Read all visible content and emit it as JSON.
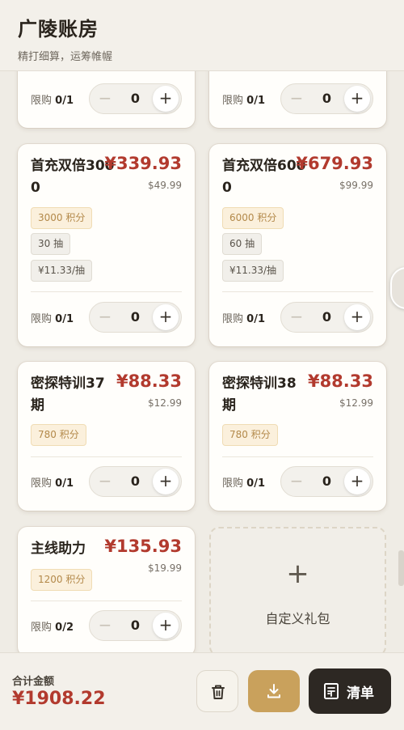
{
  "header": {
    "title": "广陵账房",
    "subtitle": "精打细算，运筹帷幄"
  },
  "top_partial": [
    {
      "limit_label": "限购",
      "limit": "0/1",
      "qty": "0",
      "minus": "−",
      "plus": "+"
    },
    {
      "limit_label": "限购",
      "limit": "0/1",
      "qty": "0",
      "minus": "−",
      "plus": "+"
    }
  ],
  "cards": [
    {
      "name": "首充双倍3000",
      "price": "¥339.93",
      "usd": "$49.99",
      "points_tag": "3000 积分",
      "tags": [
        "30 抽",
        "¥11.33/抽"
      ],
      "limit_label": "限购",
      "limit": "0/1",
      "qty": "0",
      "minus": "−",
      "plus": "+"
    },
    {
      "name": "首充双倍6000",
      "price": "¥679.93",
      "usd": "$99.99",
      "points_tag": "6000 积分",
      "tags": [
        "60 抽",
        "¥11.33/抽"
      ],
      "limit_label": "限购",
      "limit": "0/1",
      "qty": "0",
      "minus": "−",
      "plus": "+"
    },
    {
      "name": "密探特训37期",
      "price": "¥88.33",
      "usd": "$12.99",
      "points_tag": "780 积分",
      "limit_label": "限购",
      "limit": "0/1",
      "qty": "0",
      "minus": "−",
      "plus": "+"
    },
    {
      "name": "密探特训38期",
      "price": "¥88.33",
      "usd": "$12.99",
      "points_tag": "780 积分",
      "limit_label": "限购",
      "limit": "0/1",
      "qty": "0",
      "minus": "−",
      "plus": "+"
    },
    {
      "name": "主线助力",
      "price": "¥135.93",
      "usd": "$19.99",
      "points_tag": "1200 积分",
      "limit_label": "限购",
      "limit": "0/2",
      "qty": "0",
      "minus": "−",
      "plus": "+"
    }
  ],
  "custom_pack": {
    "icon": "+",
    "label": "自定义礼包"
  },
  "footer": {
    "total_label": "合计金额",
    "total_value": "¥1908.22",
    "list_label": "清单"
  },
  "colors": {
    "price": "#b23a2e",
    "gold": "#c9a15c",
    "dark": "#2d2823",
    "background": "#efece5"
  }
}
